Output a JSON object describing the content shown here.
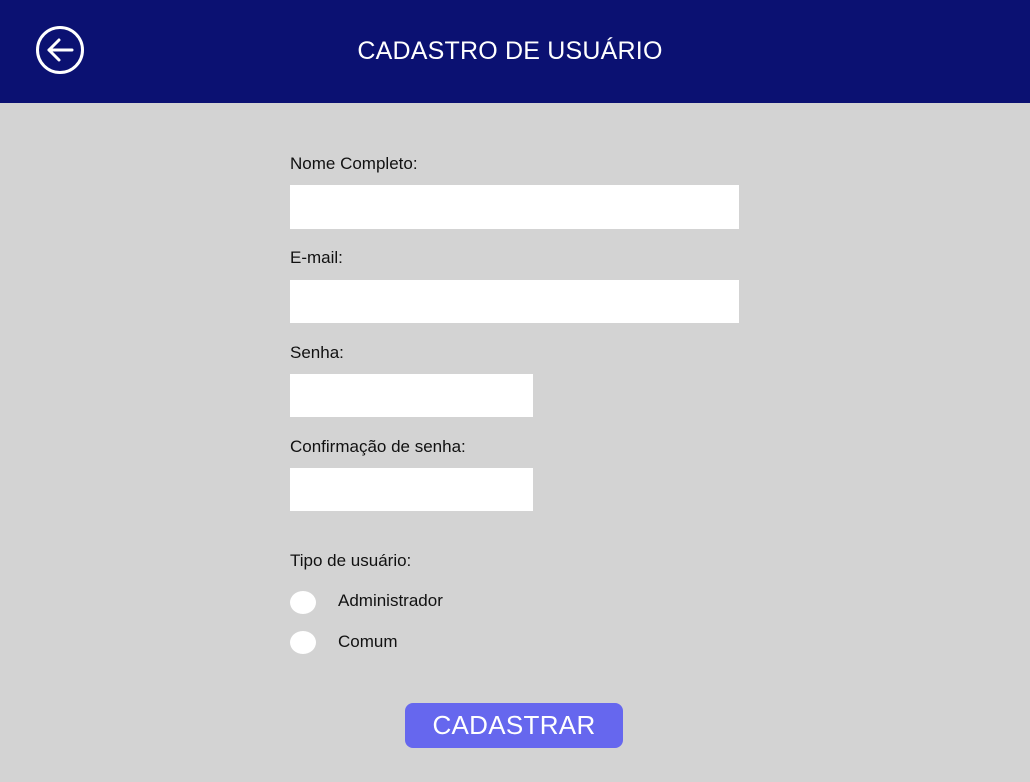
{
  "header": {
    "title": "CADASTRO DE USUÁRIO",
    "back_icon": "arrow-left-circle-icon"
  },
  "form": {
    "full_name": {
      "label": "Nome Completo:"
    },
    "email": {
      "label": "E-mail:"
    },
    "password": {
      "label": "Senha:"
    },
    "password_confirm": {
      "label": "Confirmação de senha:"
    },
    "user_type": {
      "label": "Tipo de usuário:",
      "options": [
        "Administrador",
        "Comum"
      ]
    },
    "submit_label": "CADASTRAR"
  },
  "colors": {
    "header_bg": "#0b1172",
    "page_bg": "#d3d3d3",
    "button_bg": "#6667ee",
    "input_bg": "#ffffff"
  }
}
